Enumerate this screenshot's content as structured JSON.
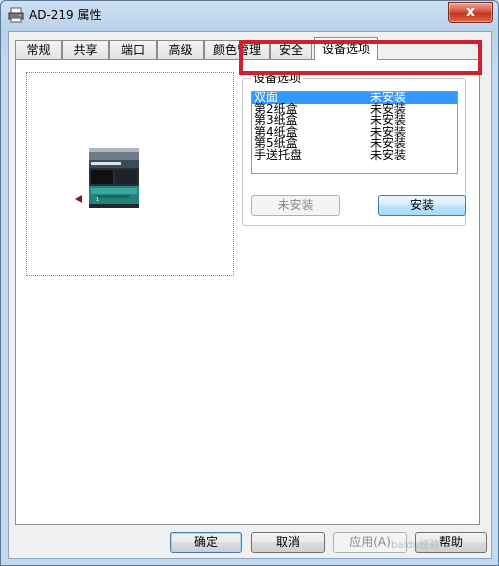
{
  "window": {
    "title": "AD-219 属性",
    "close_symbol": "x"
  },
  "tabs": [
    {
      "label": "常规"
    },
    {
      "label": "共享"
    },
    {
      "label": "端口"
    },
    {
      "label": "高级"
    },
    {
      "label": "颜色管理"
    },
    {
      "label": "安全"
    },
    {
      "label": "设备选项",
      "active": true
    }
  ],
  "device_options": {
    "group_label": "设备选项",
    "items": [
      {
        "name": "双面",
        "status": "未安装",
        "selected": true
      },
      {
        "name": "第2纸盒",
        "status": "未安装"
      },
      {
        "name": "第3纸盒",
        "status": "未安装"
      },
      {
        "name": "第4纸盒",
        "status": "未安装"
      },
      {
        "name": "第5纸盒",
        "status": "未安装"
      },
      {
        "name": "手送托盘",
        "status": "未安装"
      }
    ],
    "uninstall_label": "未安装",
    "install_label": "安装"
  },
  "preview": {
    "printer_label": "1"
  },
  "footer": {
    "ok": "确定",
    "cancel": "取消",
    "apply": "应用(A)",
    "help": "帮助"
  },
  "watermark": "baidu经验",
  "colors": {
    "accent_selection": "#3399ff",
    "highlight_frame": "#d11f2f",
    "close_button": "#c5331a"
  }
}
